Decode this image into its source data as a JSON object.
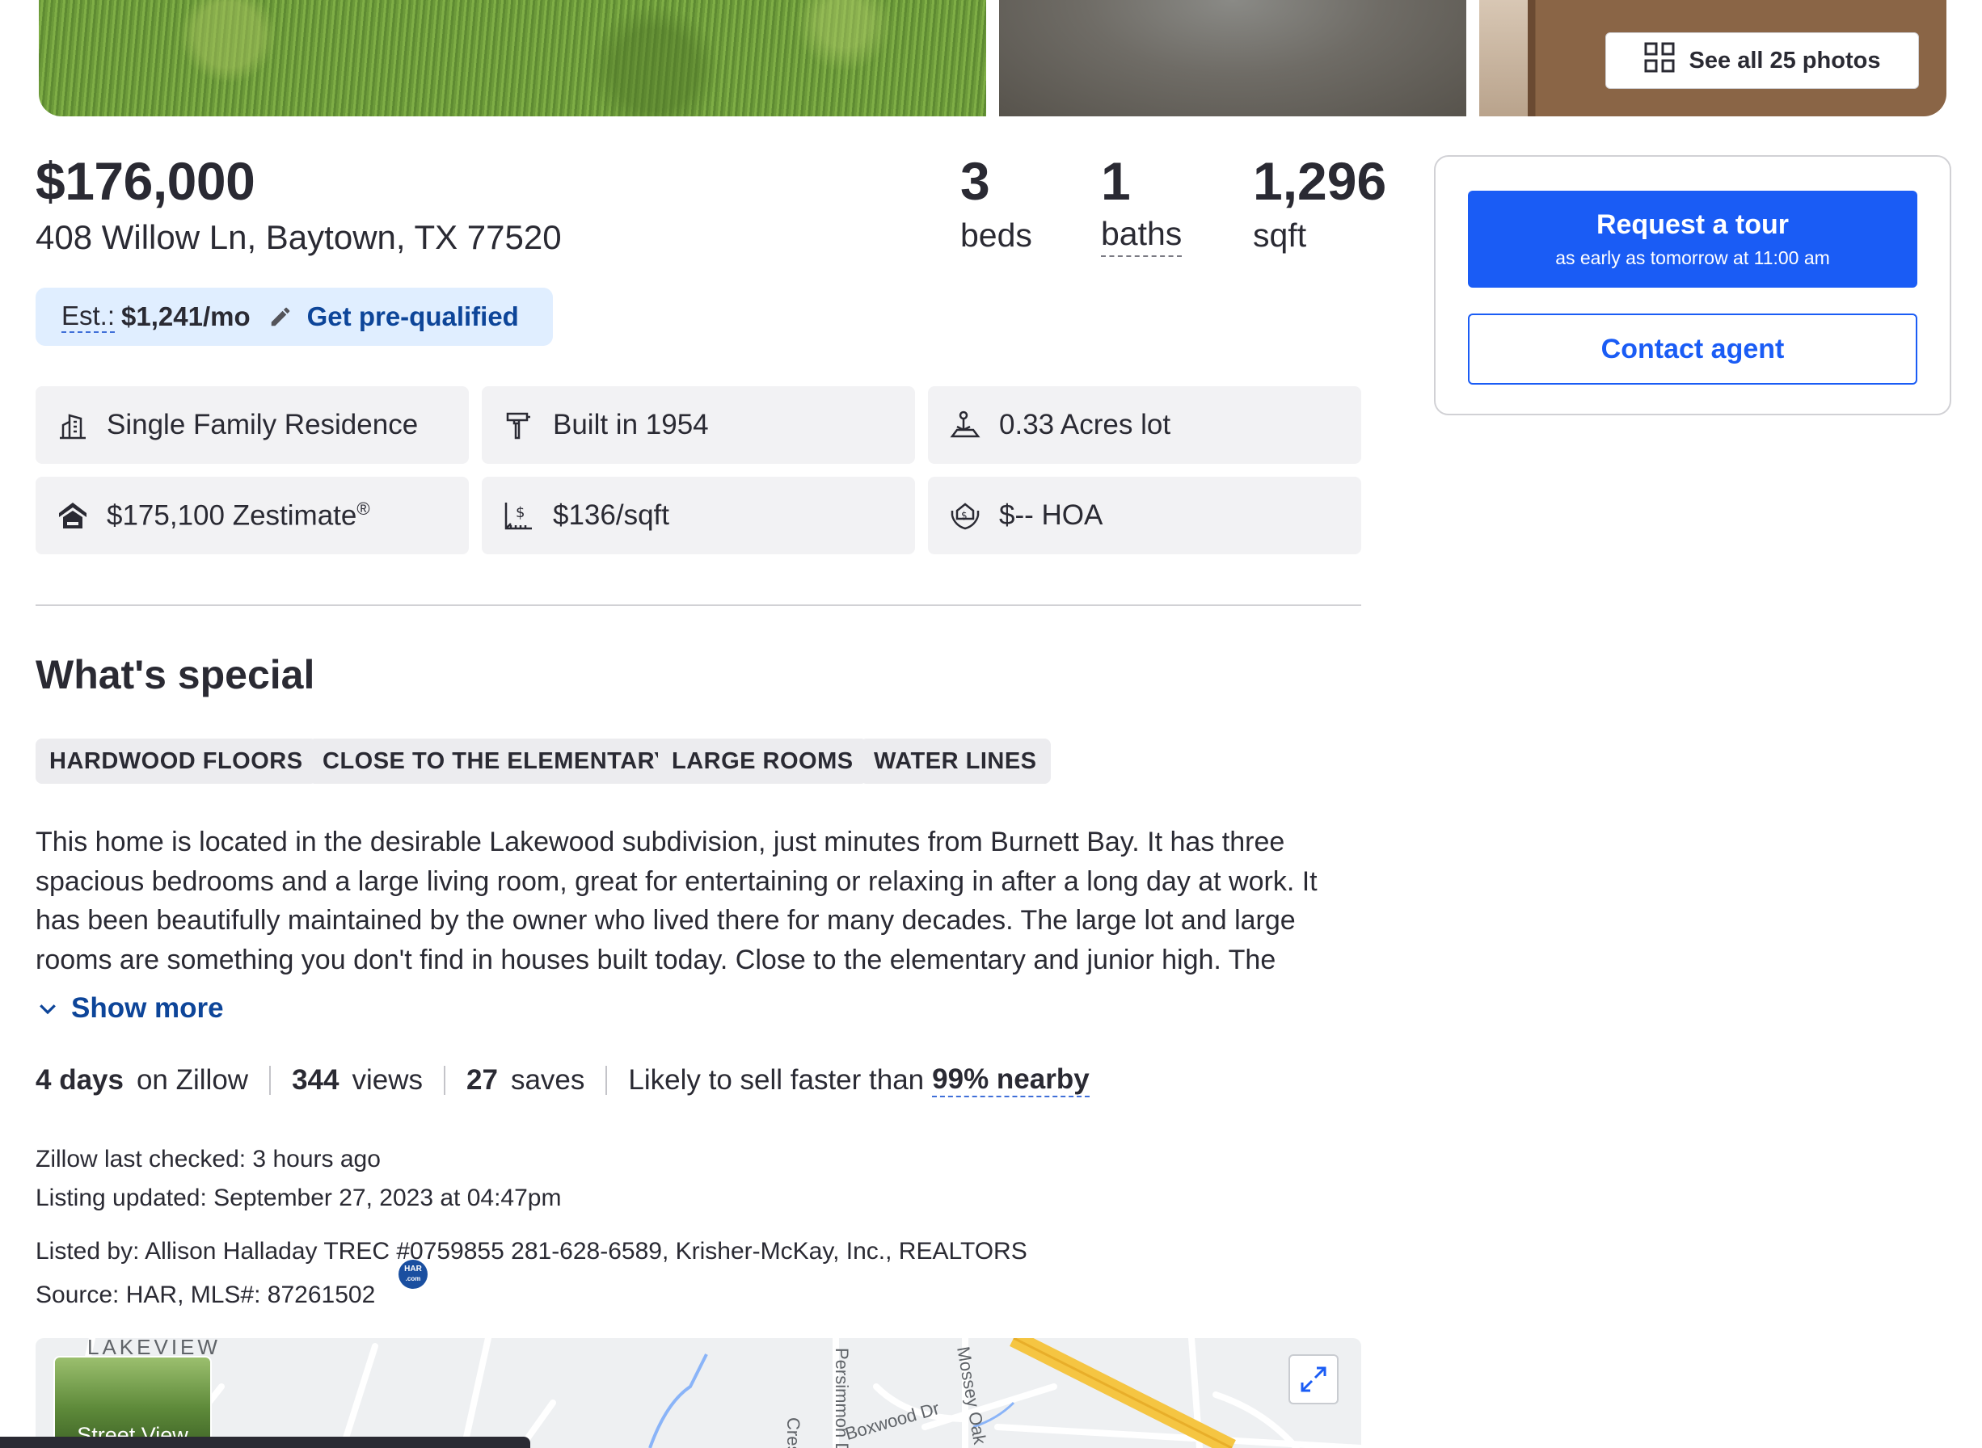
{
  "photos": {
    "see_all_label": "See all 25 photos"
  },
  "listing": {
    "price": "$176,000",
    "address": "408 Willow Ln, Baytown, TX 77520",
    "beds_value": "3",
    "beds_label": "beds",
    "baths_value": "1",
    "baths_label": "baths",
    "sqft_value": "1,296",
    "sqft_label": "sqft"
  },
  "payment": {
    "est_label": "Est.:",
    "est_value": "$1,241/mo",
    "prequal_label": "Get pre-qualified"
  },
  "facts": [
    {
      "icon": "building-icon",
      "text": "Single Family Residence"
    },
    {
      "icon": "hammer-icon",
      "text": "Built in 1954"
    },
    {
      "icon": "lot-icon",
      "text": "0.33 Acres lot"
    },
    {
      "icon": "zestimate-icon",
      "text": "$175,100 Zestimate",
      "sup": "®"
    },
    {
      "icon": "price-per-sqft-icon",
      "text": "$136/sqft"
    },
    {
      "icon": "hoa-icon",
      "text": "$-- HOA"
    }
  ],
  "whats_special": {
    "title": "What's special",
    "chips": [
      "HARDWOOD FLOORS",
      "CLOSE TO THE ELEMENTARY",
      "LARGE ROOMS",
      "WATER LINES"
    ],
    "description": "This home is located in the desirable Lakewood subdivision, just minutes from Burnett Bay. It has three spacious bedrooms and a large living room, great for entertaining or relaxing in after a long day at work. It has been beautifully maintained by the owner who lived there for many decades. The large lot and large rooms are something you don't find in houses built today. Close to the elementary and junior high. The",
    "show_more": "Show more"
  },
  "stats": {
    "days_value": "4 days",
    "days_label": "on Zillow",
    "views_value": "344",
    "views_label": "views",
    "saves_value": "27",
    "saves_label": "saves",
    "likely_text": "Likely to sell faster than",
    "likely_value": "99% nearby"
  },
  "meta": {
    "last_checked": "Zillow last checked: 3 hours ago",
    "listing_updated": "Listing updated: September 27, 2023 at 04:47pm",
    "listed_by": "Listed by: Allison Halladay TREC #0759855 281-628-6589, Krisher-McKay, Inc., REALTORS",
    "source": "Source: HAR,  MLS#: 87261502",
    "har_badge_line1": "HAR",
    "har_badge_line2": ".com"
  },
  "map": {
    "street_view_label": "Street View",
    "labels": {
      "lakeview": "LAKEVIEW",
      "persimmon": "Persimmon Dr",
      "mossey": "Mossey Oak Dr",
      "boxwood": "Boxwood Dr",
      "cres": "Cres"
    }
  },
  "cta": {
    "tour_label": "Request a tour",
    "tour_sub": "as early as tomorrow at 11:00 am",
    "contact_label": "Contact agent"
  },
  "colors": {
    "brand_blue": "#1a5cf5",
    "link_blue": "#0d4599",
    "text": "#2a2a33",
    "pill_bg": "#e0eeff",
    "tile_bg": "#f2f2f4"
  }
}
